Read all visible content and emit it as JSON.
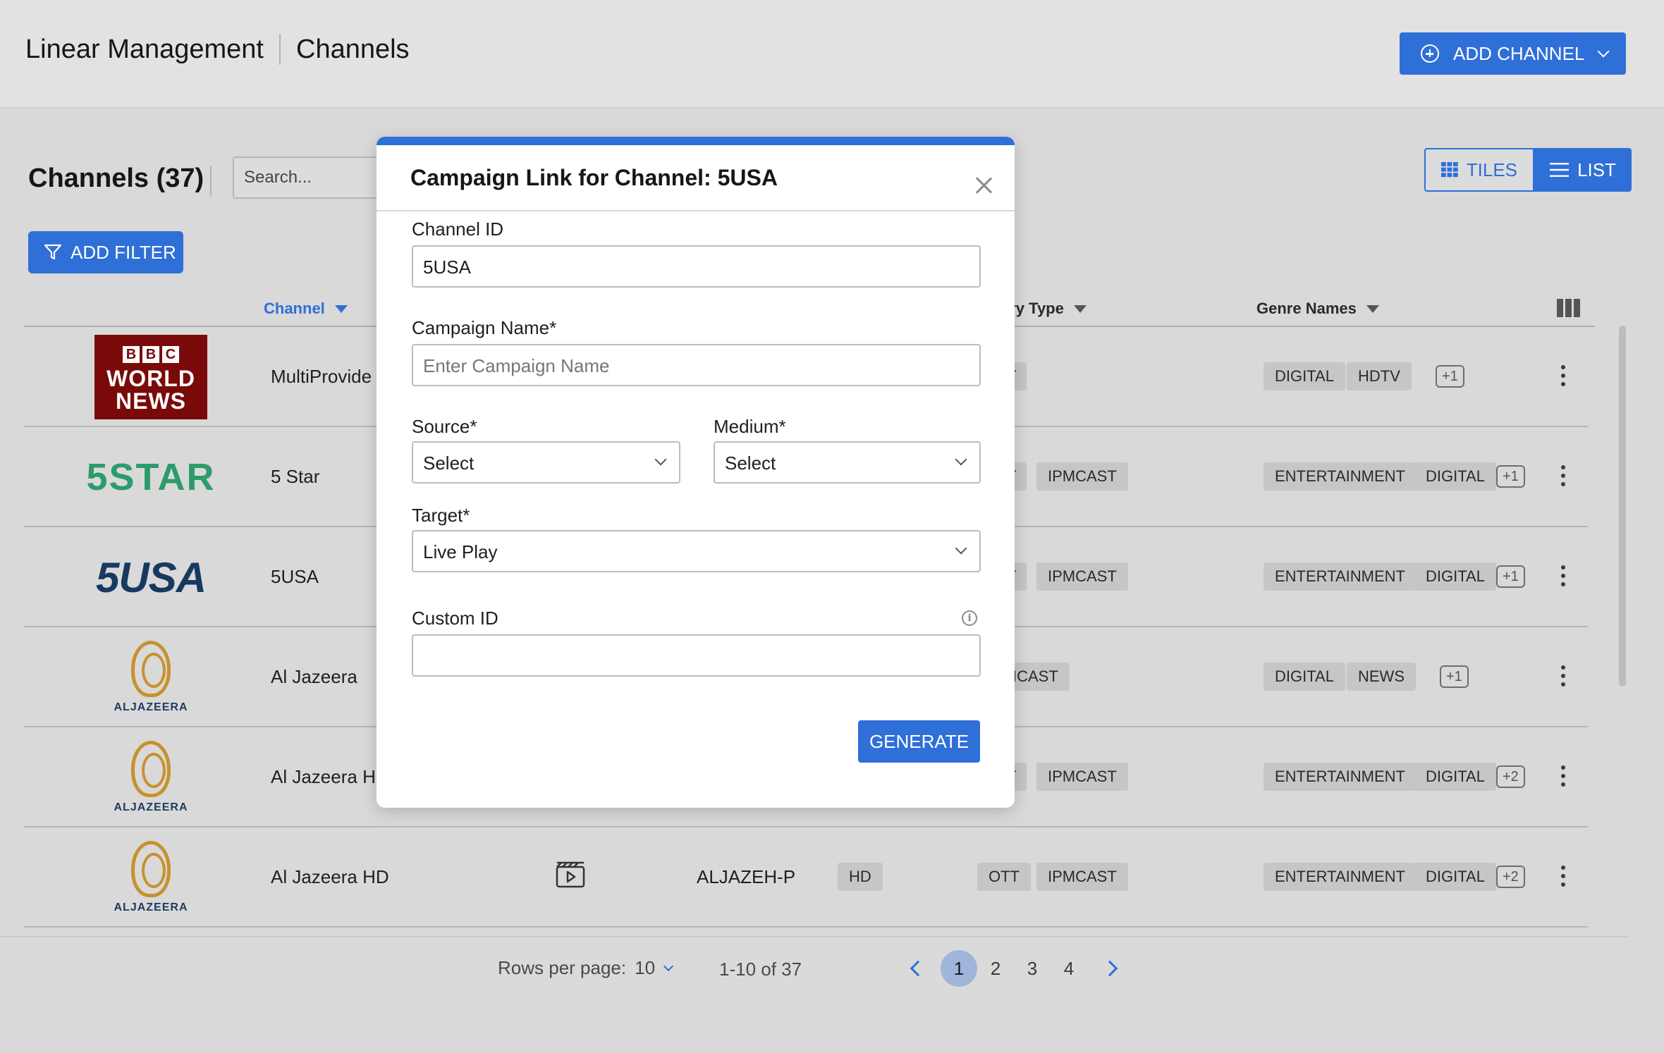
{
  "header": {
    "breadcrumb": [
      "Linear Management",
      "Channels"
    ],
    "add_channel_label": "ADD CHANNEL"
  },
  "list": {
    "title": "Channels (37)",
    "search_placeholder": "Search...",
    "add_filter_label": "ADD FILTER",
    "view_tiles_label": "TILES",
    "view_list_label": "LIST",
    "columns": {
      "channel": "Channel",
      "delivery_type": "ery Type",
      "genre_names": "Genre Names"
    },
    "rows": [
      {
        "logo": "BBC WORLD NEWS",
        "name": "MultiProvide",
        "delivery": [
          "T"
        ],
        "genres": [
          "DIGITAL",
          "HDTV"
        ],
        "more": "+1"
      },
      {
        "logo": "5STAR",
        "name": "5 Star",
        "delivery": [
          "T",
          "IPMCAST"
        ],
        "genres": [
          "ENTERTAINMENT",
          "DIGITAL"
        ],
        "more": "+1"
      },
      {
        "logo": "5USA",
        "name": "5USA",
        "delivery": [
          "T",
          "IPMCAST"
        ],
        "genres": [
          "ENTERTAINMENT",
          "DIGITAL"
        ],
        "more": "+1"
      },
      {
        "logo": "ALJAZEERA",
        "name": "Al Jazeera",
        "delivery": [
          "ICAST"
        ],
        "genres": [
          "DIGITAL",
          "NEWS"
        ],
        "more": "+1"
      },
      {
        "logo": "ALJAZEERA",
        "name": "Al Jazeera HD",
        "delivery": [
          "T",
          "IPMCAST"
        ],
        "genres": [
          "ENTERTAINMENT",
          "DIGITAL"
        ],
        "more": "+2"
      },
      {
        "logo": "ALJAZEERA",
        "name": "Al Jazeera HD",
        "code": "ALJAZEH-P",
        "quality": "HD",
        "delivery": [
          "OTT",
          "IPMCAST"
        ],
        "genres": [
          "ENTERTAINMENT",
          "DIGITAL"
        ],
        "more": "+2"
      }
    ]
  },
  "footer": {
    "rows_per_page_label": "Rows per page:",
    "rows_per_page_value": "10",
    "range": "1-10 of 37",
    "pages": [
      "1",
      "2",
      "3",
      "4"
    ],
    "active_page": "1"
  },
  "modal": {
    "title": "Campaign Link for Channel: 5USA",
    "channel_id_label": "Channel ID",
    "channel_id_value": "5USA",
    "campaign_name_label": "Campaign Name*",
    "campaign_name_placeholder": "Enter Campaign Name",
    "source_label": "Source*",
    "source_value": "Select",
    "medium_label": "Medium*",
    "medium_value": "Select",
    "target_label": "Target*",
    "target_value": "Live Play",
    "custom_id_label": "Custom ID",
    "custom_id_value": "",
    "generate_label": "GENERATE"
  },
  "colors": {
    "accent": "#2f6fd8",
    "five_star": "#2b9c6b",
    "five_usa": "#163a5f",
    "bbc": "#7a0a0a",
    "aljazeera": "#c6922d"
  }
}
